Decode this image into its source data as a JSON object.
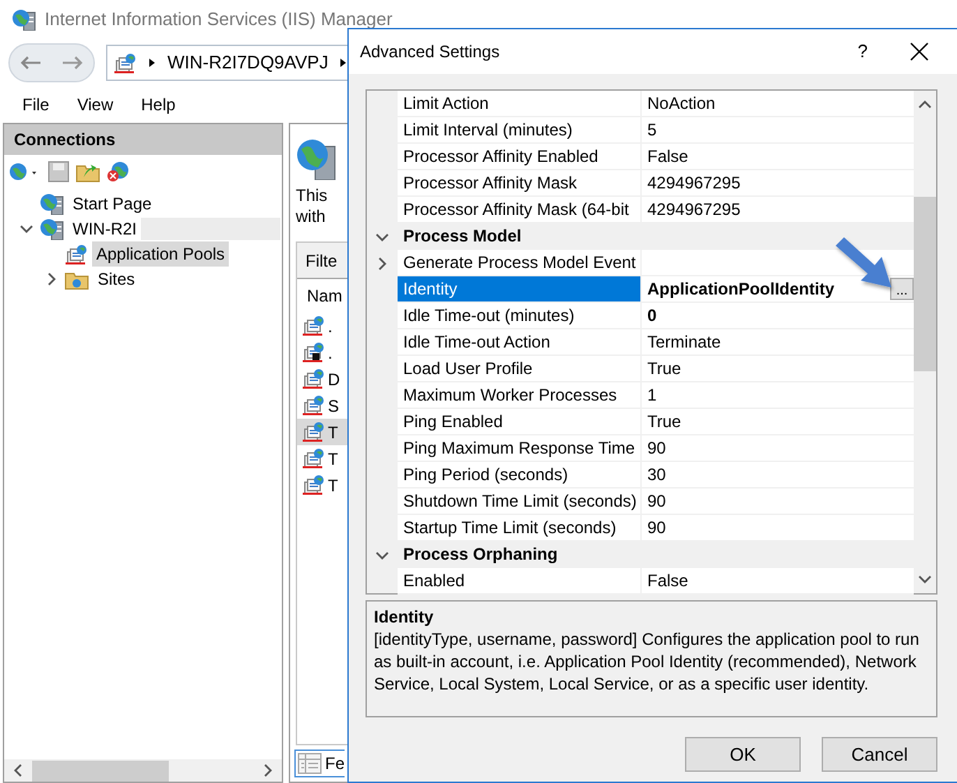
{
  "window": {
    "title": "Internet Information Services (IIS) Manager"
  },
  "address_bar": {
    "segments": [
      "WIN-R2I7DQ9AVPJ"
    ]
  },
  "menu": [
    "File",
    "View",
    "Help"
  ],
  "connections": {
    "title": "Connections",
    "tree": [
      {
        "label": "Start Page",
        "selected": false,
        "kind": "server"
      },
      {
        "label": "WIN-R2I",
        "redacted": true,
        "expanded": true,
        "selected": false,
        "kind": "server",
        "children": [
          {
            "label": "Application Pools",
            "selected": true,
            "kind": "pool"
          },
          {
            "label": "Sites",
            "expanded": false,
            "selected": false,
            "kind": "folder"
          }
        ]
      }
    ]
  },
  "content": {
    "lines": [
      "This",
      "with"
    ],
    "filter_label": "Filte",
    "column_header": "Nam",
    "rows": [
      {
        "label": ".",
        "kind": "running",
        "selected": false
      },
      {
        "label": ".",
        "kind": "stopped",
        "selected": false
      },
      {
        "label": "D",
        "kind": "running",
        "selected": false
      },
      {
        "label": "S",
        "kind": "running",
        "selected": false
      },
      {
        "label": "T",
        "kind": "running",
        "selected": true
      },
      {
        "label": "T",
        "kind": "running",
        "selected": false
      },
      {
        "label": "T",
        "kind": "running",
        "selected": false
      }
    ],
    "bottom_tab": "Fe"
  },
  "dialog": {
    "title": "Advanced Settings",
    "help": "?",
    "rows": [
      {
        "kind": "property",
        "name": "Limit Action",
        "value": "NoAction",
        "modified": false,
        "selected": false
      },
      {
        "kind": "property",
        "name": "Limit Interval (minutes)",
        "value": "5",
        "modified": false,
        "selected": false
      },
      {
        "kind": "property",
        "name": "Processor Affinity Enabled",
        "value": "False",
        "modified": false,
        "selected": false
      },
      {
        "kind": "property",
        "name": "Processor Affinity Mask",
        "value": "4294967295",
        "modified": false,
        "selected": false
      },
      {
        "kind": "property",
        "name": "Processor Affinity Mask (64-bit",
        "value": "4294967295",
        "modified": false,
        "selected": false
      },
      {
        "kind": "category",
        "name": "Process Model",
        "expanded": true
      },
      {
        "kind": "property",
        "name": "Generate Process Model Event",
        "expanded": false,
        "selected": false
      },
      {
        "kind": "property",
        "name": "Identity",
        "value": "ApplicationPoolIdentity",
        "modified": true,
        "selected": true,
        "button": "..."
      },
      {
        "kind": "property",
        "name": "Idle Time-out (minutes)",
        "value": "0",
        "modified": true,
        "selected": false
      },
      {
        "kind": "property",
        "name": "Idle Time-out Action",
        "value": "Terminate",
        "modified": false,
        "selected": false
      },
      {
        "kind": "property",
        "name": "Load User Profile",
        "value": "True",
        "modified": false,
        "selected": false
      },
      {
        "kind": "property",
        "name": "Maximum Worker Processes",
        "value": "1",
        "modified": false,
        "selected": false
      },
      {
        "kind": "property",
        "name": "Ping Enabled",
        "value": "True",
        "modified": false,
        "selected": false
      },
      {
        "kind": "property",
        "name": "Ping Maximum Response Time",
        "value": "90",
        "modified": false,
        "selected": false
      },
      {
        "kind": "property",
        "name": "Ping Period (seconds)",
        "value": "30",
        "modified": false,
        "selected": false
      },
      {
        "kind": "property",
        "name": "Shutdown Time Limit (seconds)",
        "value": "90",
        "modified": false,
        "selected": false
      },
      {
        "kind": "property",
        "name": "Startup Time Limit (seconds)",
        "value": "90",
        "modified": false,
        "selected": false
      },
      {
        "kind": "category",
        "name": "Process Orphaning",
        "expanded": true
      },
      {
        "kind": "property",
        "name": "Enabled",
        "value": "False",
        "modified": false,
        "selected": false
      }
    ],
    "description": {
      "title": "Identity",
      "text": "[identityType, username, password] Configures the application pool to run as built-in account, i.e. Application Pool Identity (recommended), Network Service, Local System, Local Service, or as a specific user identity."
    },
    "buttons": [
      "OK",
      "Cancel"
    ]
  }
}
